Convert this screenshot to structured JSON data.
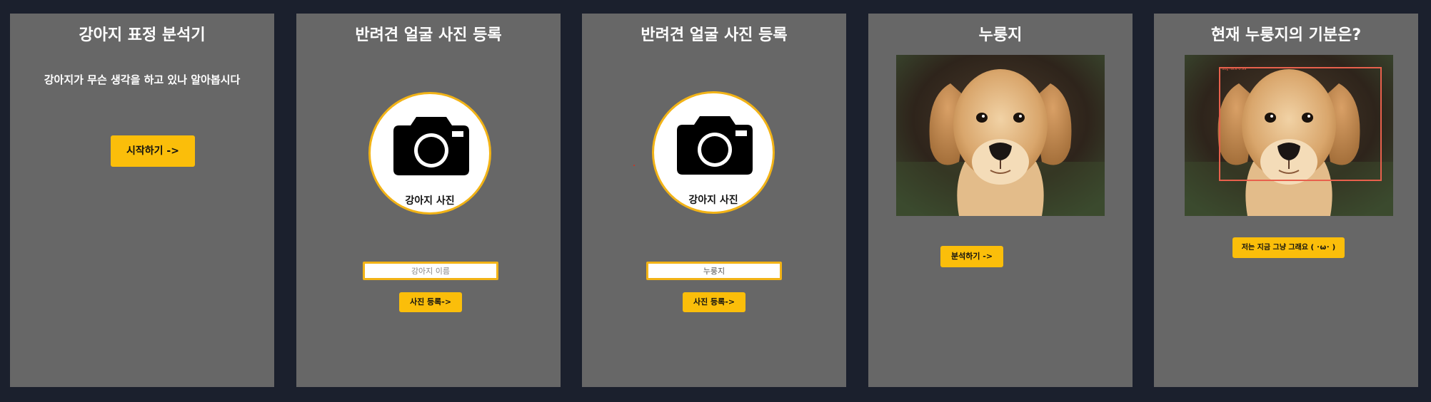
{
  "panels": {
    "start": {
      "title": "강아지 표정 분석기",
      "subtitle": "강아지가 무슨 생각을 하고 있나 알아봅시다",
      "start_button": "시작하기 ->"
    },
    "register_empty": {
      "title": "반려견 얼굴 사진 등록",
      "photo_label": "강아지 사진",
      "name_placeholder": "강아지 이름",
      "upload_button": "사진 등록->"
    },
    "register_filled": {
      "title": "반려견 얼굴 사진 등록",
      "photo_label": "강아지 사진",
      "name_value": "누룽지",
      "upload_button": "사진 등록->"
    },
    "preview": {
      "title": "누룽지",
      "analyze_button": "분석하기 ->"
    },
    "result": {
      "title": "현재 누룽지의 기분은?",
      "bbox_label": "dog face 0.99",
      "result_text": "저는 지금 그냥 그래요 ( ･ω･ )"
    }
  },
  "colors": {
    "background": "#1b202d",
    "panel": "#676767",
    "accent": "#fbbe0a",
    "bbox": "#e8604c"
  },
  "icons": {
    "camera": "camera-icon"
  }
}
